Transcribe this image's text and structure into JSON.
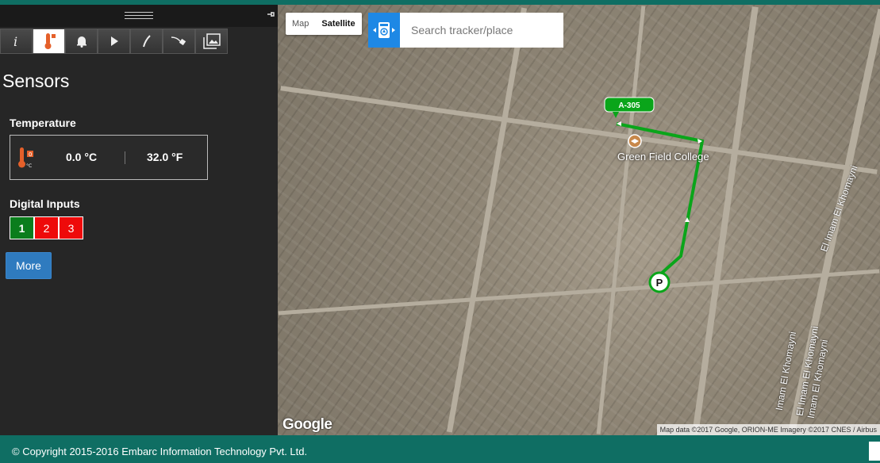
{
  "panel": {
    "title": "Sensors",
    "temperature": {
      "label": "Temperature",
      "celsius": "0.0 °C",
      "fahrenheit": "32.0 °F",
      "icon": "thermometer-icon"
    },
    "digital_inputs": {
      "label": "Digital Inputs",
      "items": [
        {
          "label": "1",
          "state": "on"
        },
        {
          "label": "2",
          "state": "off"
        },
        {
          "label": "3",
          "state": "off"
        }
      ]
    },
    "more_label": "More",
    "tabs": [
      "info-icon",
      "thermometer-icon",
      "bell-icon",
      "play-icon",
      "pen-icon",
      "plug-icon",
      "photos-icon"
    ]
  },
  "map": {
    "toggle": {
      "map": "Map",
      "satellite": "Satellite"
    },
    "search_placeholder": "Search tracker/place",
    "route_badge": "A-305",
    "parking_badge": "P",
    "place_label": "Green Field College",
    "street_labels": [
      "El Imam El Khomayni",
      "El Imam El Khomayni",
      "Imam El Khomayni",
      "Imam El Khomayni"
    ],
    "google_logo": "Google",
    "attribution": "Map data ©2017 Google, ORION-ME Imagery ©2017 CNES / Airbus"
  },
  "colors": {
    "accent": "#0f6e63",
    "route": "#0aa51a",
    "di_on": "#0a7d1c",
    "di_off": "#ee0a0a",
    "button": "#2f7bbf"
  },
  "footer": {
    "text": "© Copyright 2015-2016 Embarc Information Technology Pvt. Ltd."
  }
}
